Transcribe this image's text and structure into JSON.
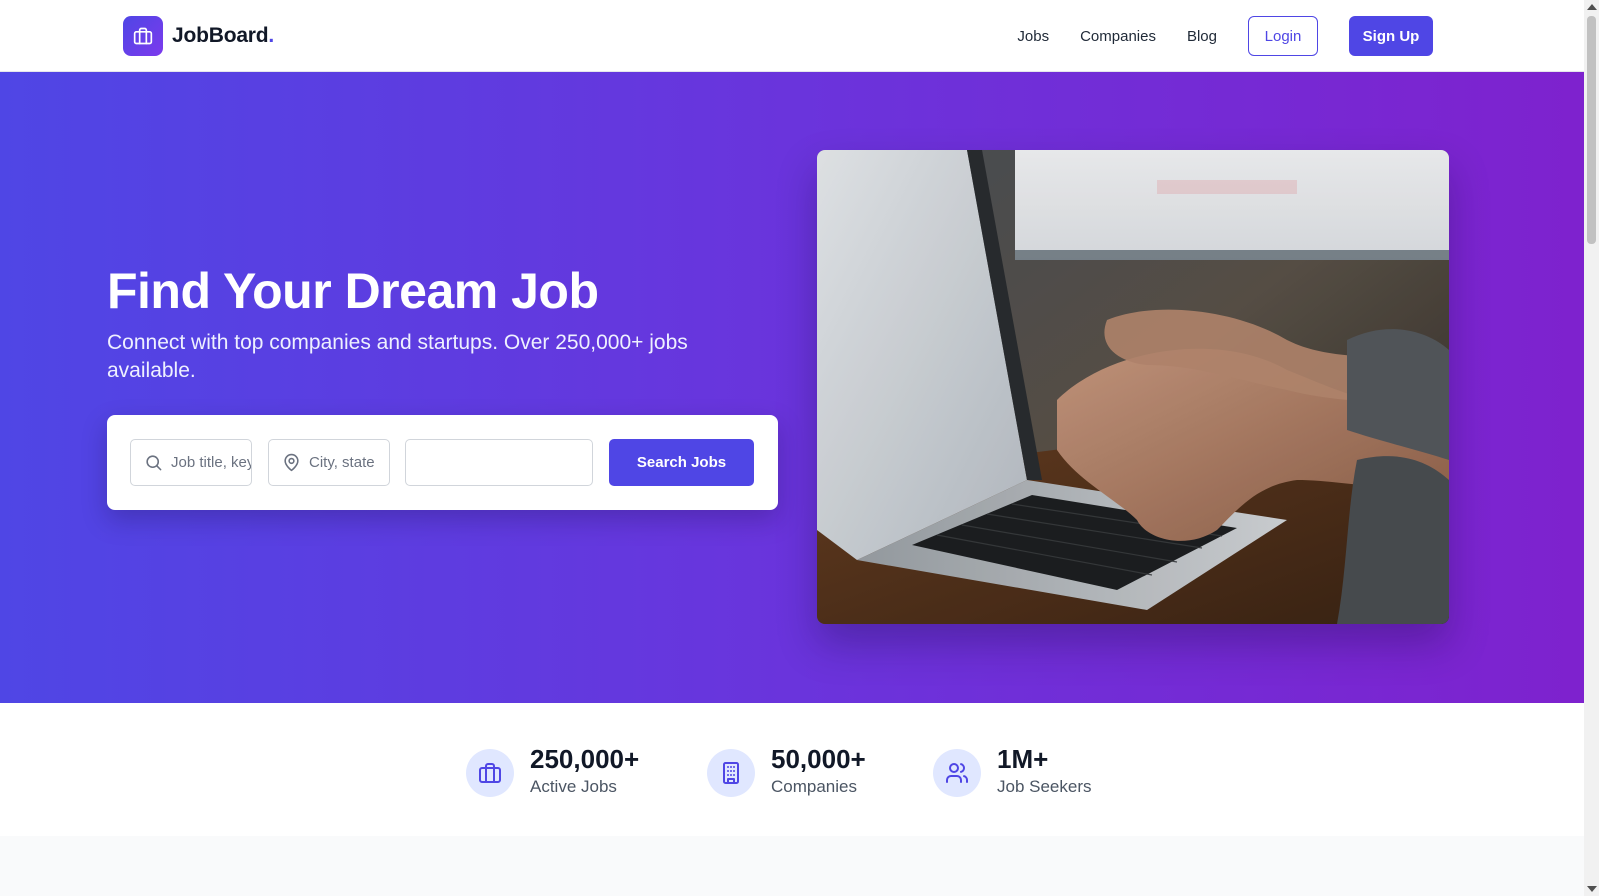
{
  "brand": {
    "name": "JobBoard",
    "dot": ".",
    "icon": "briefcase-icon"
  },
  "nav": {
    "links": [
      "Jobs",
      "Companies",
      "Blog"
    ],
    "login_label": "Login",
    "signup_label": "Sign Up"
  },
  "hero": {
    "title": "Find Your Dream Job",
    "subtitle": "Connect with top companies and startups. Over 250,000+ jobs available.",
    "image_alt": "Hands typing on a laptop keyboard"
  },
  "search": {
    "keyword_placeholder": "Job title, keywords",
    "keyword_value": "",
    "keyword_icon": "search-icon",
    "location_placeholder": "City, state",
    "location_value": "",
    "location_icon": "map-pin-icon",
    "third_value": "",
    "button_label": "Search Jobs"
  },
  "stats": [
    {
      "value": "250,000+",
      "label": "Active Jobs",
      "icon": "briefcase-icon"
    },
    {
      "value": "50,000+",
      "label": "Companies",
      "icon": "building-icon"
    },
    {
      "value": "1M+",
      "label": "Job Seekers",
      "icon": "users-icon"
    }
  ],
  "colors": {
    "primary": "#4f46e5",
    "gradient_end": "#7e22ce",
    "stat_icon_bg": "#e0e7ff"
  }
}
